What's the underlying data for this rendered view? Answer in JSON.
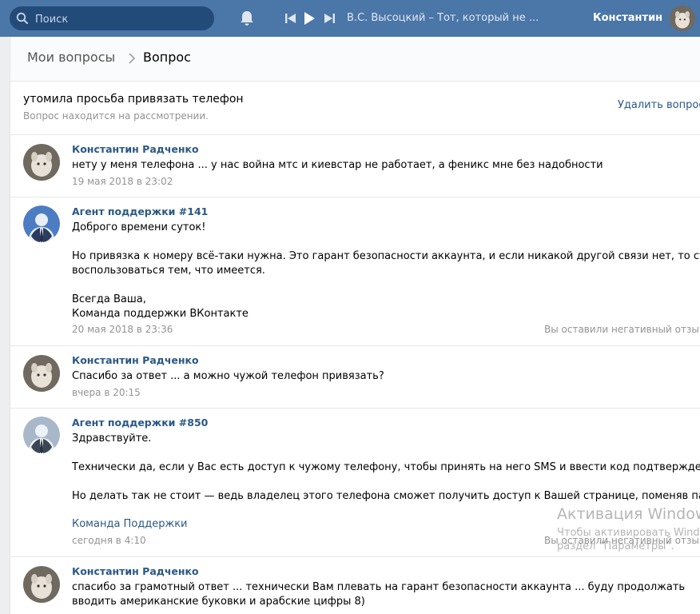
{
  "header": {
    "search_placeholder": "Поиск",
    "player": {
      "track": "В.С. Высоцкий – Тот, который не ..."
    },
    "user_name": "Константин"
  },
  "breadcrumb": {
    "parent": "Мои вопросы",
    "current": "Вопрос"
  },
  "question": {
    "title": "утомила просьба привязать телефон",
    "status": "Вопрос находится на рассмотрении.",
    "delete_label": "Удалить вопрос"
  },
  "messages": [
    {
      "author": "Константин Радченко",
      "lines": [
        "нету у меня телефона ... у нас война мтс и киевстар не работает, а феникс мне без надобности"
      ],
      "time": "19 мая 2018 в 23:02"
    },
    {
      "author": "Агент поддержки #141",
      "lines": [
        "Доброго времени суток!",
        "",
        "Но привязка к номеру всё-таки нужна. Это гарант безопасности аккаунта, и если никакой другой связи нет, то стоит",
        "воспользоваться тем, что имеется.",
        "",
        "Всегда Ваша,",
        "Команда поддержки ВКонтакте"
      ],
      "time": "20 мая 2018 в 23:36",
      "feedback": "Вы оставили негативный отзыв"
    },
    {
      "author": "Константин Радченко",
      "lines": [
        "Спасибо за ответ ... а можно чужой телефон привязать?"
      ],
      "time": "вчера в 20:15"
    },
    {
      "author": "Агент поддержки #850",
      "lines": [
        "Здравствуйте.",
        "",
        "Технически да, если у Вас есть доступ к чужому телефону, чтобы принять на него SMS и ввести код подтверждения.",
        "",
        "Но делать так не стоит — ведь владелец этого телефона сможет получить доступ к Вашей странице, поменяв пароль."
      ],
      "signature": "Команда Поддержки",
      "time": "сегодня в 4:10",
      "feedback": "Вы оставили негативный отзыв"
    },
    {
      "author": "Константин Радченко",
      "lines": [
        "спасибо за грамотный ответ ... технически Вам плевать на гарант безопасности аккаунта ... буду продолжать",
        "вводить американские буковки и арабские цифры 8)"
      ]
    }
  ],
  "watermark": {
    "title": "Активация Windows",
    "line1": "Чтобы активировать Windows, перейдите в",
    "line2": "раздел \"Параметры\"."
  }
}
